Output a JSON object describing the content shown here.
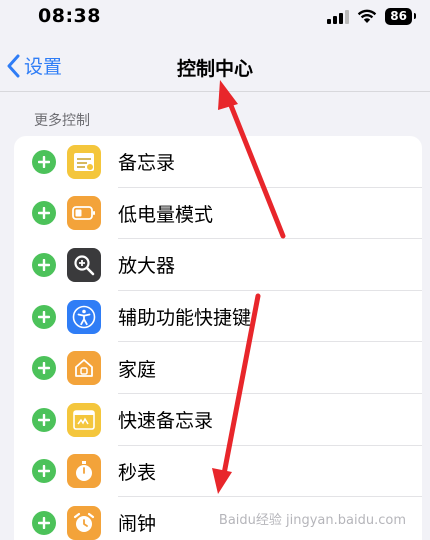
{
  "status": {
    "time": "08:38",
    "battery": "86"
  },
  "nav": {
    "back_label": "设置",
    "title": "控制中心"
  },
  "section": {
    "header": "更多控制"
  },
  "items": [
    {
      "label": "备忘录",
      "icon": "notes-icon",
      "color": "#f4c63c"
    },
    {
      "label": "低电量模式",
      "icon": "low-power-icon",
      "color": "#f3a33a"
    },
    {
      "label": "放大器",
      "icon": "magnifier-icon",
      "color": "#3a3a3c"
    },
    {
      "label": "辅助功能快捷键",
      "icon": "accessibility-icon",
      "color": "#2f7df6"
    },
    {
      "label": "家庭",
      "icon": "home-icon",
      "color": "#f3a33a"
    },
    {
      "label": "快速备忘录",
      "icon": "quick-note-icon",
      "color": "#f4c63c"
    },
    {
      "label": "秒表",
      "icon": "stopwatch-icon",
      "color": "#f3a33a"
    },
    {
      "label": "闹钟",
      "icon": "alarm-icon",
      "color": "#f3a33a"
    }
  ],
  "watermark": "Baidu经验 jingyan.baidu.com",
  "colors": {
    "add": "#4cc25a",
    "accent": "#2f7df6",
    "arrow": "#e8262b"
  }
}
